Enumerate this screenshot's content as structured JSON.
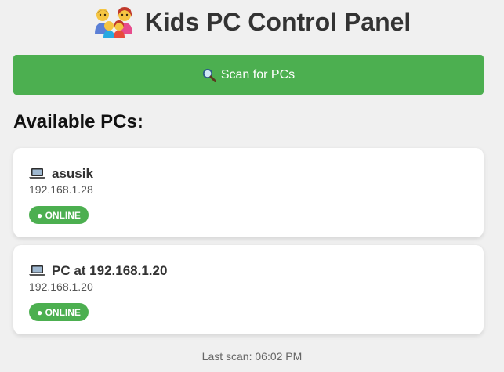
{
  "header": {
    "title": "Kids PC Control Panel",
    "icon": "family-icon"
  },
  "scan_button": {
    "label": "Scan for PCs",
    "icon": "magnifier-icon",
    "color": "#4caf50"
  },
  "section": {
    "heading": "Available PCs:"
  },
  "pcs": [
    {
      "name": "asusik",
      "ip": "192.168.1.28",
      "status": "● ONLINE",
      "icon": "laptop-icon"
    },
    {
      "name": "PC at 192.168.1.20",
      "ip": "192.168.1.20",
      "status": "● ONLINE",
      "icon": "laptop-icon"
    }
  ],
  "status_color": "#4caf50",
  "footer": {
    "last_scan": "Last scan: 06:02 PM"
  }
}
